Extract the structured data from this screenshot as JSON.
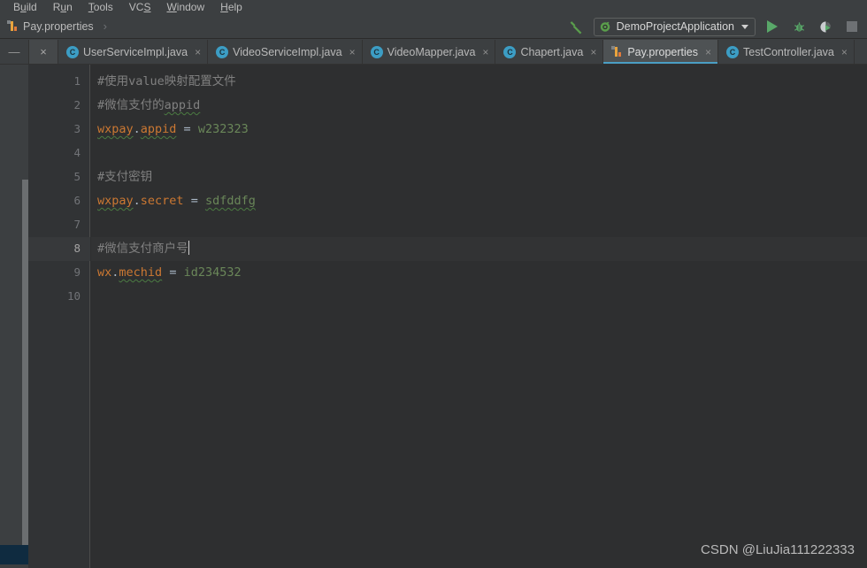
{
  "menubar": {
    "items": [
      {
        "pre": "B",
        "mn": "u",
        "post": "ild"
      },
      {
        "pre": "R",
        "mn": "u",
        "post": "n"
      },
      {
        "pre": "",
        "mn": "T",
        "post": "ools"
      },
      {
        "pre": "VC",
        "mn": "S",
        "post": ""
      },
      {
        "pre": "",
        "mn": "W",
        "post": "indow"
      },
      {
        "pre": "",
        "mn": "H",
        "post": "elp"
      }
    ]
  },
  "navbar": {
    "crumb_label": "Pay.properties",
    "crumb_icon": "properties-file-icon",
    "separator": "›"
  },
  "toolbar": {
    "build_icon": "hammer-icon",
    "run_config": {
      "label": "DemoProjectApplication",
      "icon": "spring-boot-icon",
      "dropdown_icon": "chevron-down-icon"
    },
    "run_icon": "run-play-icon",
    "debug_icon": "debug-bug-icon",
    "coverage_icon": "run-with-coverage-icon",
    "stop_icon": "stop-square-icon"
  },
  "toolwindow_header": {
    "minimize_label": "—",
    "close_label": "×"
  },
  "tabs": [
    {
      "label": "UserServiceImpl.java",
      "icon": "java-class-icon",
      "icon_letter": "C",
      "active": false,
      "close": "×"
    },
    {
      "label": "VideoServiceImpl.java",
      "icon": "java-class-icon",
      "icon_letter": "C",
      "active": false,
      "close": "×"
    },
    {
      "label": "VideoMapper.java",
      "icon": "java-class-icon",
      "icon_letter": "C",
      "active": false,
      "close": "×"
    },
    {
      "label": "Chapert.java",
      "icon": "java-class-icon",
      "icon_letter": "C",
      "active": false,
      "close": "×"
    },
    {
      "label": "Pay.properties",
      "icon": "properties-file-icon",
      "icon_letter": "",
      "active": true,
      "close": "×"
    },
    {
      "label": "TestController.java",
      "icon": "java-class-icon",
      "icon_letter": "C",
      "active": false,
      "close": "×"
    }
  ],
  "editor": {
    "line_numbers": [
      "1",
      "2",
      "3",
      "4",
      "5",
      "6",
      "7",
      "8",
      "9",
      "10"
    ],
    "current_line": 8,
    "lines": [
      {
        "n": 1,
        "segments": [
          {
            "t": "#使用value映射配置文件",
            "c": "cmt"
          }
        ]
      },
      {
        "n": 2,
        "segments": [
          {
            "t": "#微信支付的",
            "c": "cmt"
          },
          {
            "t": "appid",
            "c": "cmt sq"
          }
        ]
      },
      {
        "n": 3,
        "segments": [
          {
            "t": "wxpay",
            "c": "key sq"
          },
          {
            "t": ".",
            "c": "dot"
          },
          {
            "t": "appid",
            "c": "key sq"
          },
          {
            "t": " = ",
            "c": "eq"
          },
          {
            "t": "w232323",
            "c": "val"
          }
        ]
      },
      {
        "n": 4,
        "segments": []
      },
      {
        "n": 5,
        "segments": [
          {
            "t": "#支付密钥",
            "c": "cmt"
          }
        ]
      },
      {
        "n": 6,
        "segments": [
          {
            "t": "wxpay",
            "c": "key sq"
          },
          {
            "t": ".",
            "c": "dot"
          },
          {
            "t": "secret",
            "c": "key"
          },
          {
            "t": " = ",
            "c": "eq"
          },
          {
            "t": "sdfddfg",
            "c": "val sq"
          }
        ]
      },
      {
        "n": 7,
        "segments": []
      },
      {
        "n": 8,
        "segments": [
          {
            "t": "#微信支付商户号",
            "c": "cmt"
          }
        ],
        "caret": true
      },
      {
        "n": 9,
        "segments": [
          {
            "t": "wx",
            "c": "key"
          },
          {
            "t": ".",
            "c": "dot"
          },
          {
            "t": "mechid",
            "c": "key sq"
          },
          {
            "t": " = ",
            "c": "eq"
          },
          {
            "t": "id234532",
            "c": "val"
          }
        ]
      },
      {
        "n": 10,
        "segments": []
      }
    ]
  },
  "watermark": {
    "text": "CSDN @LiuJia111222333"
  },
  "colors": {
    "chrome_bg": "#3c3f41",
    "editor_bg": "#2e2f30",
    "gutter_bg": "#313335",
    "accent_tab": "#4a9ec4",
    "key_orange": "#cc7832",
    "value_green": "#6a8759",
    "comment_gray": "#808080",
    "run_green": "#59a869",
    "tool_chip_blue": "#0f2b40"
  }
}
